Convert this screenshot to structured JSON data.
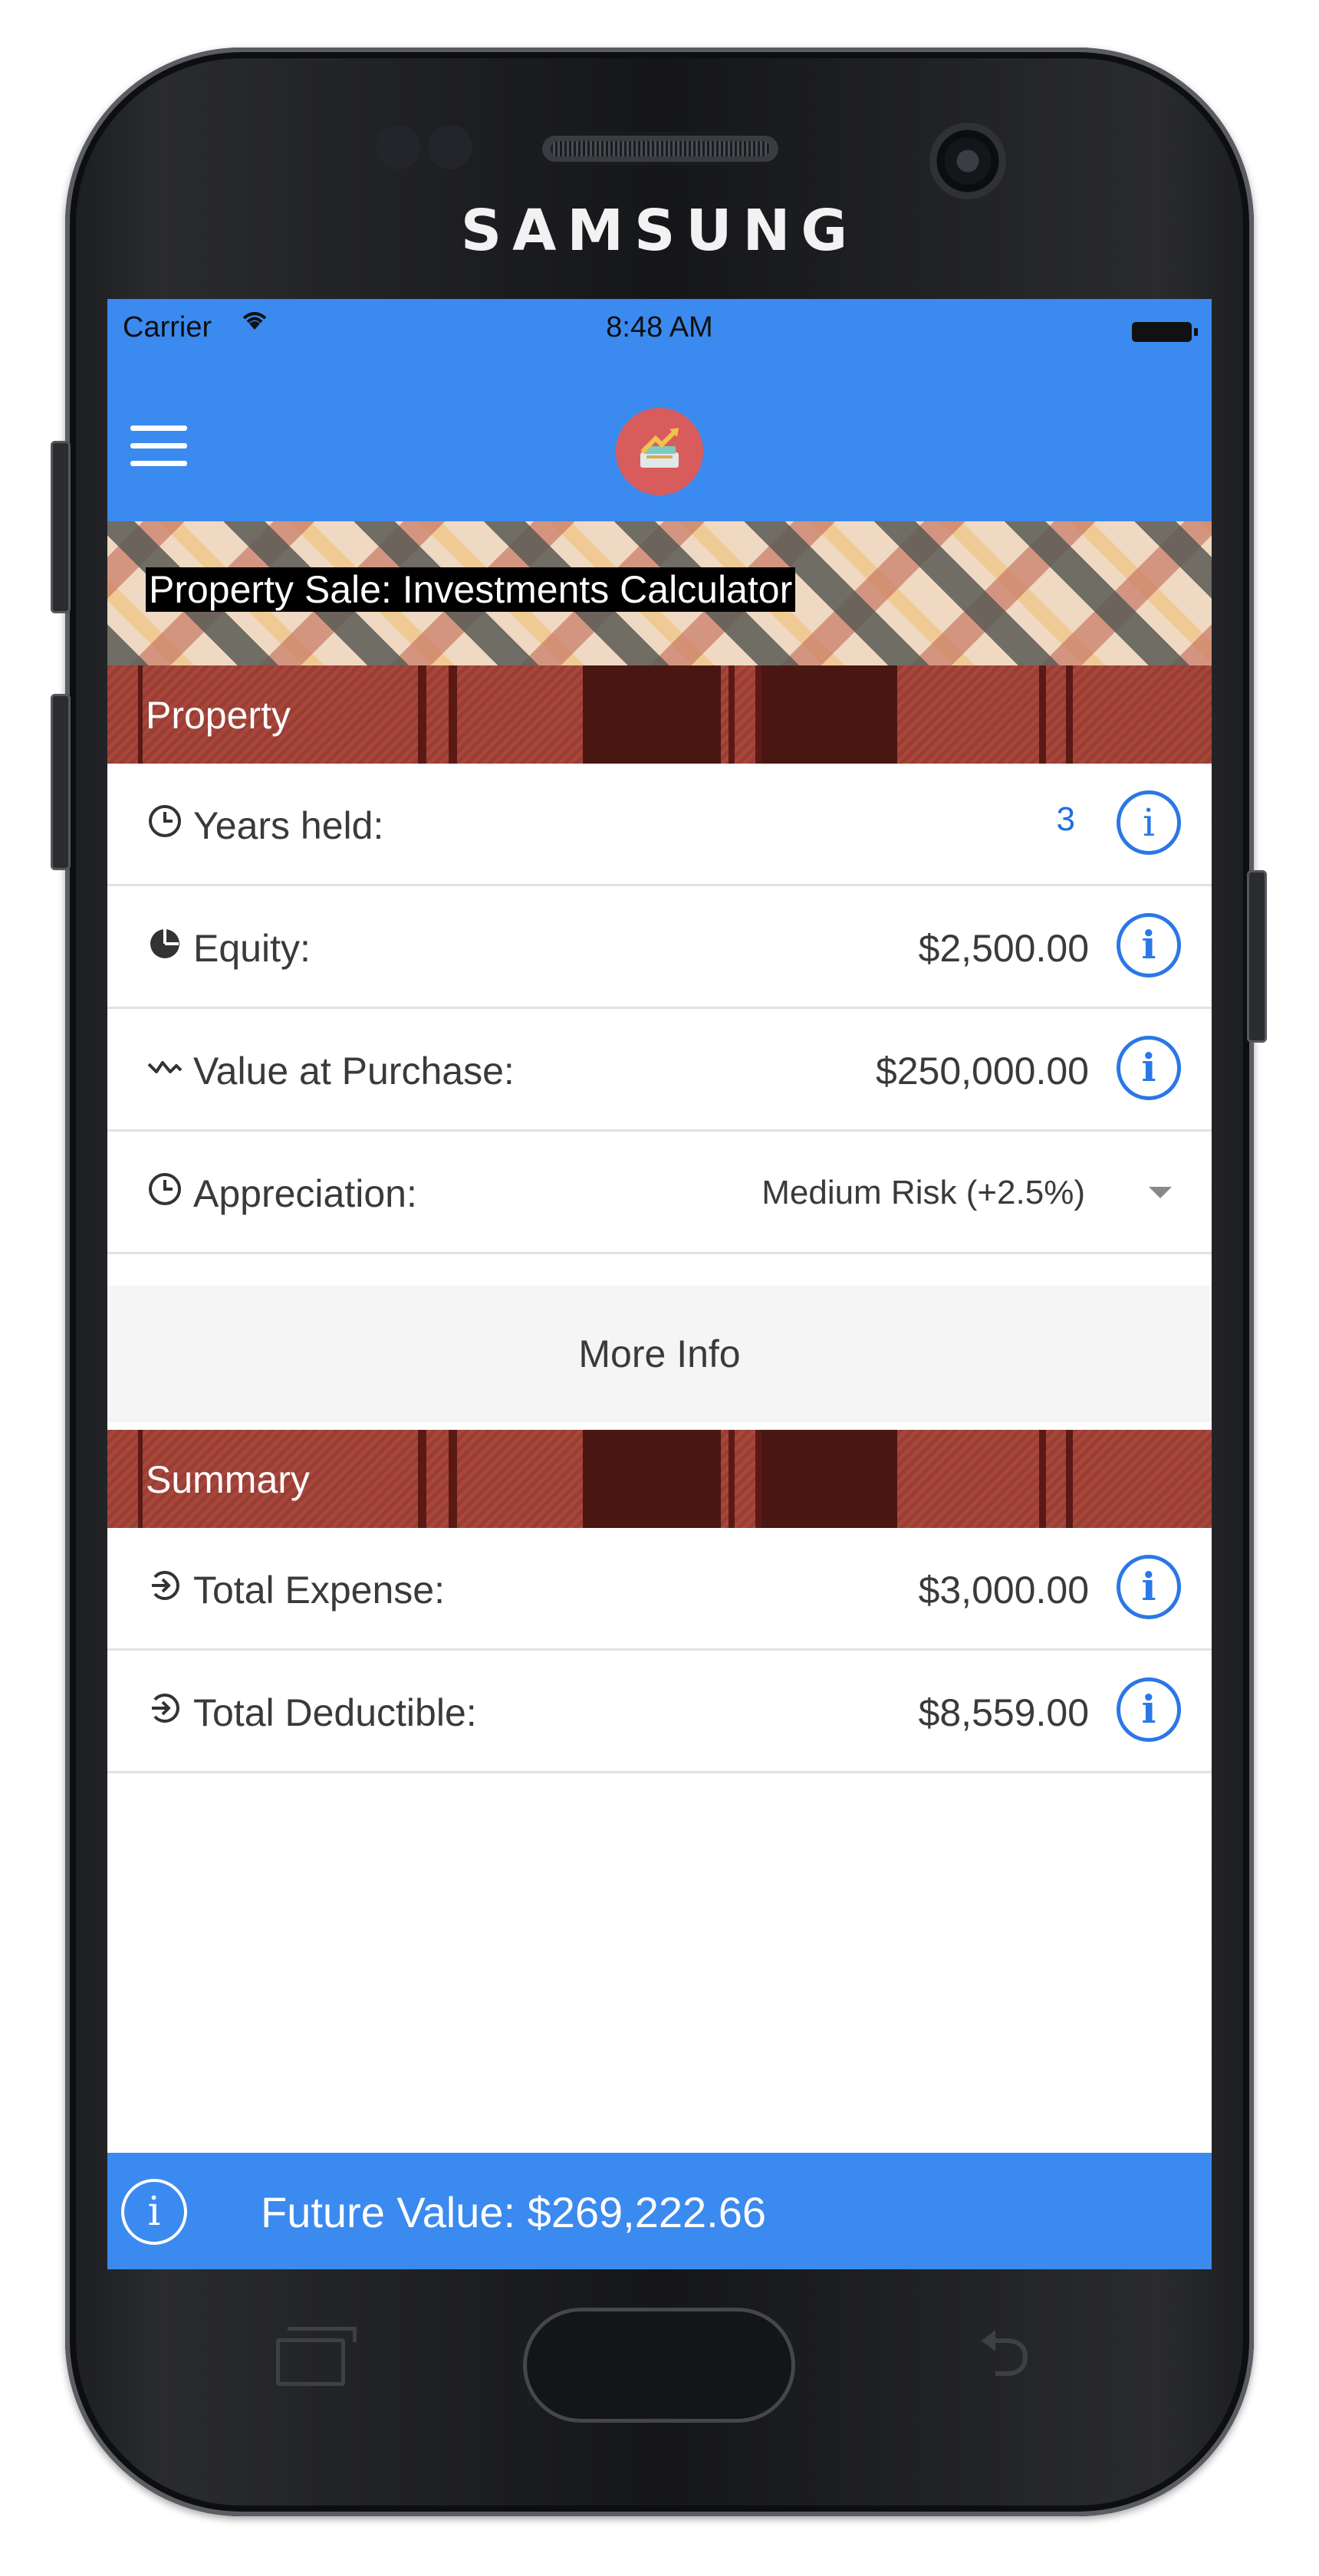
{
  "device": {
    "brand": "SAMSUNG"
  },
  "status_bar": {
    "carrier": "Carrier",
    "time": "8:48 AM"
  },
  "banner": {
    "title": "Property Sale: Investments Calculator"
  },
  "property_section": {
    "header": "Property",
    "rows": [
      {
        "icon": "clock-icon",
        "label": "Years held:",
        "value": "3"
      },
      {
        "icon": "pie-chart-icon",
        "label": "Equity:",
        "value": "$2,500.00"
      },
      {
        "icon": "trend-icon",
        "label": "Value at Purchase:",
        "value": "$250,000.00"
      },
      {
        "icon": "clock-icon",
        "label": "Appreciation:",
        "value": "Medium Risk (+2.5%)"
      }
    ],
    "more_info_label": "More Info"
  },
  "summary_section": {
    "header": "Summary",
    "rows": [
      {
        "icon": "arrow-circle-icon",
        "label": "Total Expense:",
        "value": "$3,000.00"
      },
      {
        "icon": "arrow-circle-icon",
        "label": "Total Deductible:",
        "value": "$8,559.00"
      }
    ]
  },
  "footer": {
    "text": "Future Value: $269,222.66"
  },
  "colors": {
    "accent": "#3b8aef",
    "info_blue": "#2a78e6",
    "section_red": "#a7473c"
  }
}
